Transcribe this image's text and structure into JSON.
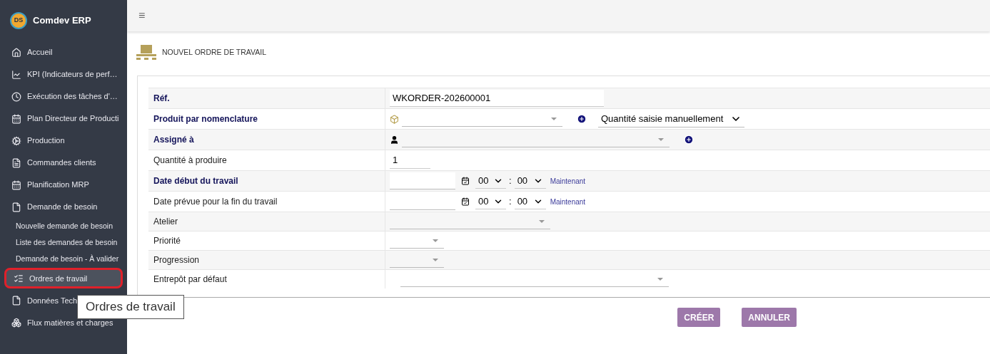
{
  "sidebar": {
    "brand": "Comdev ERP",
    "logo": "DS",
    "items": [
      {
        "label": "Accueil",
        "selected": false
      },
      {
        "label": "KPI (Indicateurs de perf…",
        "selected": false
      },
      {
        "label": "Exécution des tâches d'…",
        "selected": false
      },
      {
        "label": "Plan Directeur de Producti",
        "selected": false
      },
      {
        "label": "Production",
        "selected": false
      },
      {
        "label": "Commandes clients",
        "selected": false
      },
      {
        "label": "Planification MRP",
        "selected": false
      },
      {
        "label": "Demande de besoin",
        "selected": false,
        "children": [
          {
            "label": "Nouvelle demande de besoin"
          },
          {
            "label": "Liste des demandes de besoin"
          },
          {
            "label": "Demande de besoin - À valider"
          }
        ]
      },
      {
        "label": "Ordres de travail",
        "selected": true
      },
      {
        "label": "Données Tech",
        "selected": false
      },
      {
        "label": "Flux matières et charges",
        "selected": false
      }
    ]
  },
  "tooltip": "Ordres de travail",
  "topbar": {
    "menu": "≡"
  },
  "page": {
    "title": "NOUVEL ORDRE DE TRAVAIL"
  },
  "form": {
    "rows": [
      {
        "kind": "text",
        "label": "Réf.",
        "bold": true,
        "value": "WKORDER-202600001"
      },
      {
        "kind": "product",
        "label": "Produit par nomenclature",
        "bold": true,
        "mode": "Quantité saisie manuellement"
      },
      {
        "kind": "user",
        "label": "Assigné à",
        "bold": true
      },
      {
        "kind": "number",
        "label": "Quantité à produire",
        "bold": false,
        "value": "1"
      },
      {
        "kind": "datetime",
        "label": "Date début du travail",
        "bold": true,
        "hour": "00",
        "sep": ":",
        "minute": "00",
        "link": "Maintenant"
      },
      {
        "kind": "datetime",
        "label": "Date prévue pour la fin du travail",
        "bold": false,
        "hour": "00",
        "sep": ":",
        "minute": "00",
        "link": "Maintenant"
      },
      {
        "kind": "select",
        "label": "Atelier",
        "bold": false
      },
      {
        "kind": "select",
        "label": "Priorité",
        "bold": false
      },
      {
        "kind": "select",
        "label": "Progression",
        "bold": false
      },
      {
        "kind": "select",
        "label": "Entrepôt par défaut",
        "bold": false
      }
    ]
  },
  "buttons": [
    "CRÉER",
    "ANNULER"
  ]
}
